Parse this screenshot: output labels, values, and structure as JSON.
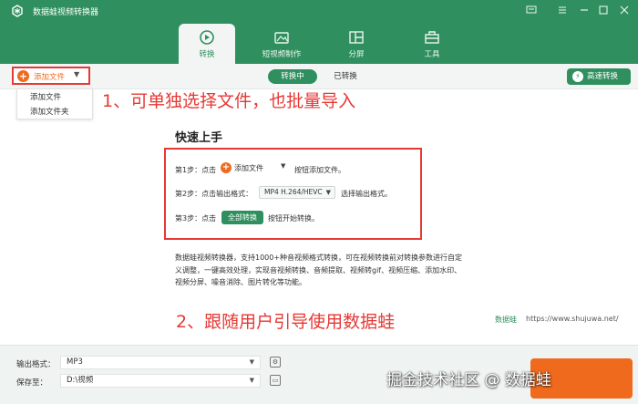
{
  "app": {
    "title": "数据蛙视频转换器",
    "window_controls": [
      "message-icon",
      "menu-icon",
      "minimize-icon",
      "maximize-icon",
      "close-icon"
    ]
  },
  "nav": {
    "tabs": [
      {
        "label": "转换",
        "icon": "convert-icon",
        "active": true
      },
      {
        "label": "短视频制作",
        "icon": "short-video-icon",
        "active": false
      },
      {
        "label": "分屏",
        "icon": "split-screen-icon",
        "active": false
      },
      {
        "label": "工具",
        "icon": "toolbox-icon",
        "active": false
      }
    ]
  },
  "toolbar": {
    "add_file_label": "添加文件",
    "segment": {
      "converting": "转换中",
      "converted": "已转换"
    },
    "speed_label": "高速转换"
  },
  "dropdown": {
    "items": [
      "添加文件",
      "添加文件夹"
    ]
  },
  "annotations": {
    "step1": "1、可单独选择文件，也批量导入",
    "step2": "2、跟随用户引导使用数据蛙"
  },
  "quickstart": {
    "title": "快速上手",
    "step1_prefix": "第1步：点击",
    "step1_button": "添加文件",
    "step1_suffix": "按钮添加文件。",
    "step2_prefix": "第2步：点击输出格式：",
    "step2_format": "MP4 H.264/HEVC",
    "step2_suffix": "选择输出格式。",
    "step3_prefix": "第3步：点击",
    "step3_button": "全部转换",
    "step3_suffix": "按钮开始转换。"
  },
  "description": "数据蛙视频转换器，支持1000+种音视频格式转换，可在视频转换前对转换参数进行自定义调整，一键高效处理，实现音视频转换、音频提取、视频转gif、视频压缩、添加水印、视频分屏、噪音消除、图片转化等功能。",
  "footer_brand": {
    "name": "数据蛙",
    "url": "https://www.shujuwa.net/"
  },
  "bottom": {
    "output_format_label": "输出格式：",
    "output_format_value": "MP3",
    "save_to_label": "保存至：",
    "save_to_value": "D:\\视频"
  },
  "watermark": "掘金技术社区 @ 数据蛙",
  "colors": {
    "brand_green": "#2f8f5e",
    "accent_orange": "#f06a1e",
    "annotation_red": "#e53935"
  }
}
